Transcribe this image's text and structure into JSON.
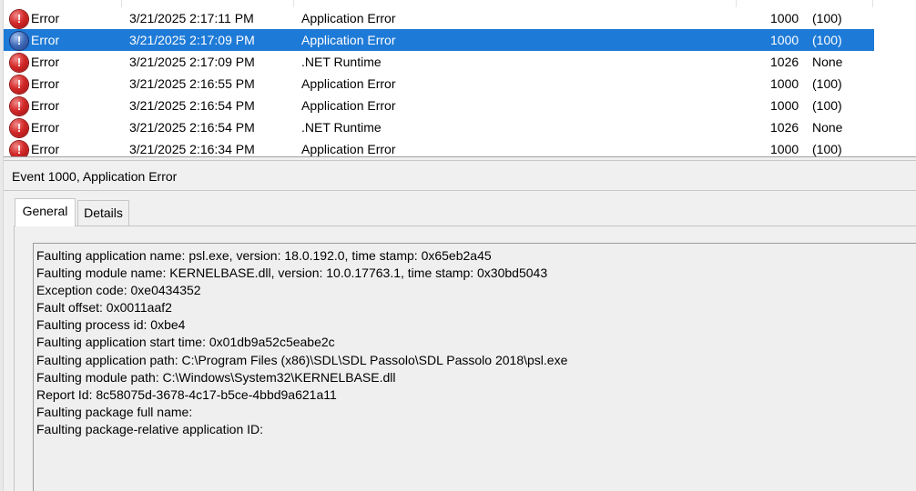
{
  "events": [
    {
      "level": "Error",
      "date": "3/21/2025 2:17:11 PM",
      "source": "Application Error",
      "id": "1000",
      "task": "(100)",
      "selected": false,
      "icon": "error-icon"
    },
    {
      "level": "Error",
      "date": "3/21/2025 2:17:09 PM",
      "source": "Application Error",
      "id": "1000",
      "task": "(100)",
      "selected": true,
      "icon": "info-icon"
    },
    {
      "level": "Error",
      "date": "3/21/2025 2:17:09 PM",
      "source": ".NET Runtime",
      "id": "1026",
      "task": "None",
      "selected": false,
      "icon": "error-icon"
    },
    {
      "level": "Error",
      "date": "3/21/2025 2:16:55 PM",
      "source": "Application Error",
      "id": "1000",
      "task": "(100)",
      "selected": false,
      "icon": "error-icon"
    },
    {
      "level": "Error",
      "date": "3/21/2025 2:16:54 PM",
      "source": "Application Error",
      "id": "1000",
      "task": "(100)",
      "selected": false,
      "icon": "error-icon"
    },
    {
      "level": "Error",
      "date": "3/21/2025 2:16:54 PM",
      "source": ".NET Runtime",
      "id": "1026",
      "task": "None",
      "selected": false,
      "icon": "error-icon"
    },
    {
      "level": "Error",
      "date": "3/21/2025 2:16:34 PM",
      "source": "Application Error",
      "id": "1000",
      "task": "(100)",
      "selected": false,
      "icon": "error-icon"
    }
  ],
  "detail": {
    "title": "Event 1000, Application Error",
    "tabs": {
      "general": "General",
      "details": "Details"
    },
    "description": [
      "Faulting application name: psl.exe, version: 18.0.192.0, time stamp: 0x65eb2a45",
      "Faulting module name: KERNELBASE.dll, version: 10.0.17763.1, time stamp: 0x30bd5043",
      "Exception code: 0xe0434352",
      "Fault offset: 0x0011aaf2",
      "Faulting process id: 0xbe4",
      "Faulting application start time: 0x01db9a52c5eabe2c",
      "Faulting application path: C:\\Program Files (x86)\\SDL\\SDL Passolo\\SDL Passolo 2018\\psl.exe",
      "Faulting module path: C:\\Windows\\System32\\KERNELBASE.dll",
      "Report Id: 8c58075d-3678-4c17-b5ce-4bbd9a621a11",
      "Faulting package full name:",
      "Faulting package-relative application ID:"
    ]
  },
  "colors": {
    "selection": "#1e7ad7",
    "error_icon": "#d42a2a",
    "info_icon": "#3e69b7"
  }
}
